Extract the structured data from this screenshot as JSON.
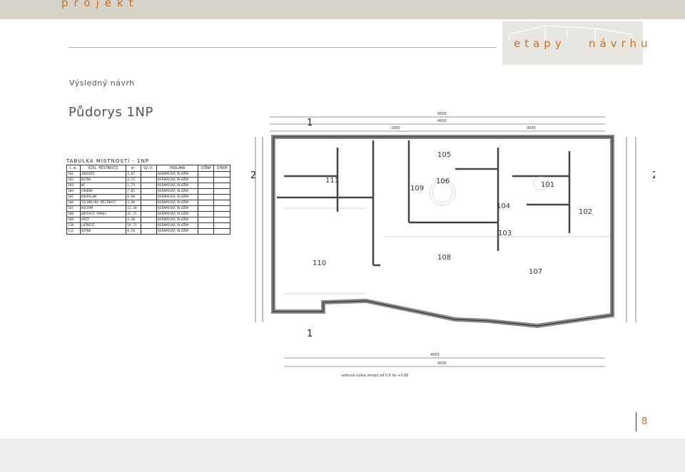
{
  "header": {
    "brand": "projekt",
    "section": "etapy   návrhu"
  },
  "subtitle": "Výsledný návrh",
  "title": "Půdorys 1NP",
  "page_number": "8",
  "room_table": {
    "caption": "TABULKA MÍSTNOSTÍ - 1NP",
    "headers": [
      "č.m.",
      "ÚČEL MÍSTNOSTI",
      "m²",
      "SV.V.",
      "PODLAHA",
      "STĚNY",
      "STROP"
    ],
    "rows": [
      [
        "101",
        "ZÁDVEŘÍ",
        "3,07",
        "",
        "KERAMICKÁ DLAŽBA",
        "",
        ""
      ],
      [
        "102",
        "ŠATNA",
        "4,25",
        "",
        "KERAMICKÁ DLAŽBA",
        "",
        ""
      ],
      [
        "103",
        "WC",
        "1,73",
        "",
        "KERAMICKÁ DLAŽBA",
        "",
        ""
      ],
      [
        "104",
        "CHODBA",
        "7,85",
        "",
        "KERAMICKÁ DLAŽBA",
        "",
        ""
      ],
      [
        "105",
        "KOUPELNA",
        "8,90",
        "",
        "KERAMICKÁ DLAŽBA",
        "",
        ""
      ],
      [
        "106",
        "TECHNICKÁ MÍSTNOST",
        "3,90",
        "",
        "KERAMICKÁ DLAŽBA",
        "",
        ""
      ],
      [
        "107",
        "KUCHYŇ",
        "12,30",
        "",
        "KERAMICKÁ DLAŽBA",
        "",
        ""
      ],
      [
        "108",
        "OBÝVACÍ POKOJ",
        "32,25",
        "",
        "KERAMICKÁ DLAŽBA",
        "",
        ""
      ],
      [
        "109",
        "SPÍŽ",
        "3,48",
        "",
        "KERAMICKÁ DLAŽBA",
        "",
        ""
      ],
      [
        "110",
        "LOŽNICE",
        "19,72",
        "",
        "KERAMICKÁ DLAŽBA",
        "",
        ""
      ],
      [
        "111",
        "ŠATNA",
        "8,50",
        "",
        "KERAMICKÁ DLAŽBA",
        "",
        ""
      ]
    ],
    "note": ""
  },
  "plan": {
    "rooms": [
      "101",
      "102",
      "103",
      "104",
      "105",
      "106",
      "107",
      "108",
      "109",
      "110",
      "111"
    ],
    "section_marks": [
      "1",
      "2"
    ],
    "dims_top": [
      "9500",
      "4950",
      "1800",
      "3650"
    ],
    "dims_bottom": [
      "4950",
      "9500"
    ],
    "footer_note": "celková výška stropu od 0,6 do +0,85"
  }
}
